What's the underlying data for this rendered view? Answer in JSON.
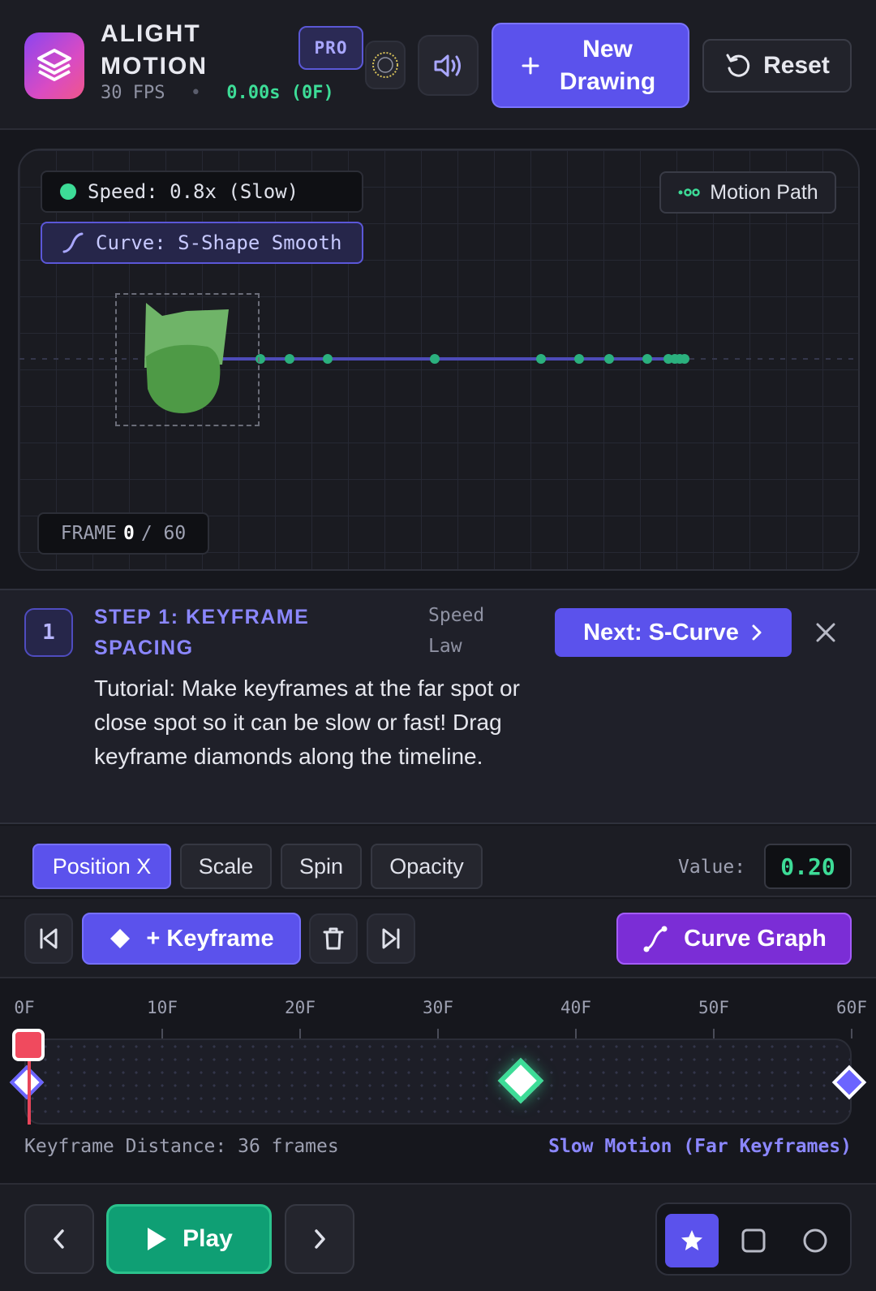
{
  "app": {
    "title_line1": "ALIGHT",
    "title_line2": "MOTION",
    "fps": "30 FPS",
    "separator": "•",
    "time": "0.00s (0F)",
    "pro_badge": "PRO"
  },
  "header": {
    "new_drawing_label": "New Drawing",
    "reset_label": "Reset"
  },
  "canvas": {
    "speed_label": "Speed: 0.8x (Slow)",
    "curve_label": "Curve: S-Shape Smooth",
    "motion_path_label": "Motion Path",
    "frame_prefix": "FRAME",
    "frame_current": "0",
    "frame_total": "/ 60"
  },
  "tutorial": {
    "step_number": "1",
    "step_title": "STEP 1: KEYFRAME SPACING",
    "law_label": "Speed Law",
    "next_label": "Next: S-Curve",
    "text": "Tutorial: Make keyframes at the far spot or close spot so it can be slow or fast! Drag keyframe diamonds along the timeline."
  },
  "properties": {
    "tabs": [
      {
        "label": "Position X",
        "active": true
      },
      {
        "label": "Scale",
        "active": false
      },
      {
        "label": "Spin",
        "active": false
      },
      {
        "label": "Opacity",
        "active": false
      }
    ],
    "value_label": "Value:",
    "value": "0.20"
  },
  "toolbar": {
    "keyframe_label": "+ Keyframe",
    "curve_graph_label": "Curve Graph"
  },
  "timeline": {
    "ticks": [
      "0F",
      "10F",
      "20F",
      "30F",
      "40F",
      "50F",
      "60F"
    ],
    "total_frames": 60,
    "playhead_frame": 0,
    "keyframes": [
      0,
      36,
      60
    ],
    "distance_text": "Keyframe Distance: 36 frames",
    "mode_text": "Slow Motion (Far Keyframes)"
  },
  "bottom": {
    "play_label": "Play",
    "shapes": [
      "star-icon",
      "square-icon",
      "circle-icon"
    ],
    "active_shape": "star-icon"
  },
  "colors": {
    "accent": "#5b52ec",
    "green": "#3ddc97",
    "curve_purple": "#7b2dd6",
    "playhead": "#f04a5e"
  }
}
